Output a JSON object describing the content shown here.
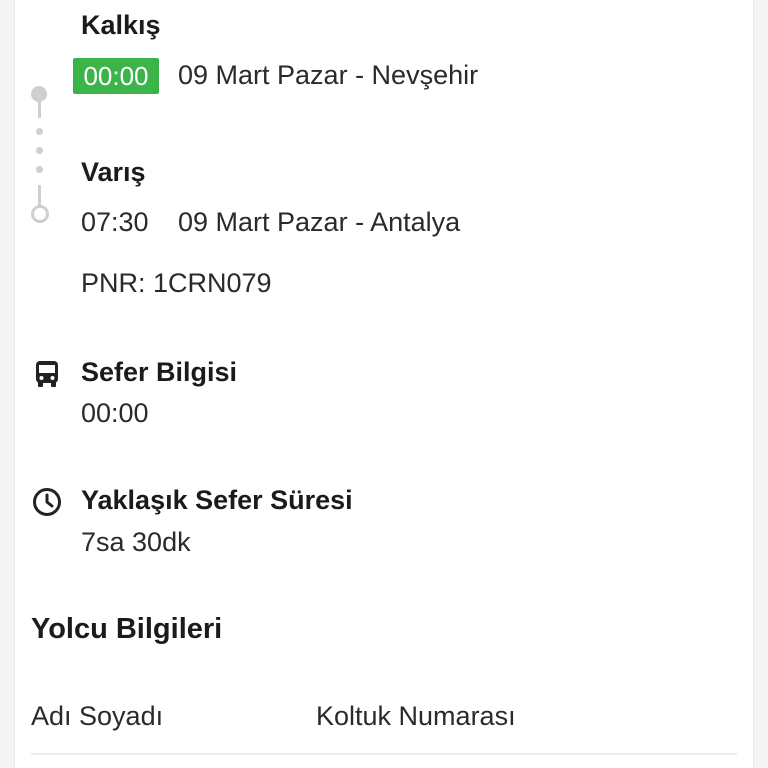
{
  "departure": {
    "title": "Kalkış",
    "time": "00:00",
    "detail": "09 Mart Pazar - Nevşehir"
  },
  "arrival": {
    "title": "Varış",
    "time": "07:30",
    "detail": "09 Mart Pazar - Antalya"
  },
  "pnr": "PNR: 1CRN079",
  "trip_info": {
    "title": "Sefer Bilgisi",
    "value": "00:00",
    "icon": "bus-icon"
  },
  "duration": {
    "title": "Yaklaşık Sefer Süresi",
    "value": "7sa 30dk",
    "icon": "clock-icon"
  },
  "passengers": {
    "title": "Yolcu Bilgileri",
    "columns": [
      "Adı Soyadı",
      "Koltuk Numarası"
    ]
  },
  "colors": {
    "badge": "#3bb54a",
    "timeline": "#cfcfcf"
  }
}
